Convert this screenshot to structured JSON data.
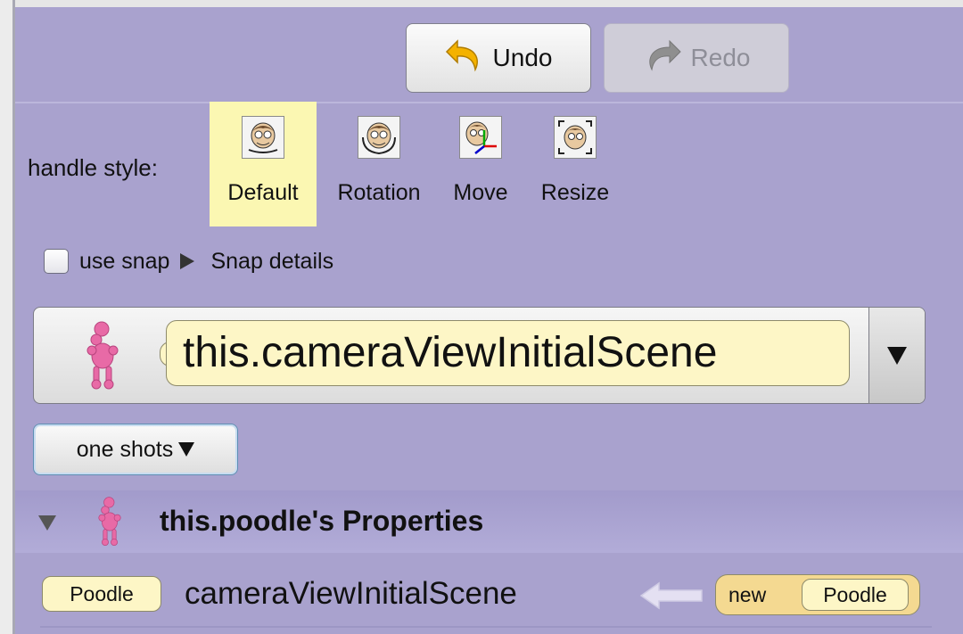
{
  "toolbar": {
    "undo_label": "Undo",
    "redo_label": "Redo",
    "redo_enabled": false
  },
  "handle_style": {
    "label": "handle style:",
    "options": [
      {
        "label": "Default",
        "selected": true
      },
      {
        "label": "Rotation",
        "selected": false
      },
      {
        "label": "Move",
        "selected": false
      },
      {
        "label": "Resize",
        "selected": false
      }
    ]
  },
  "snap": {
    "checkbox_label": "use snap",
    "checked": false,
    "details_label": "Snap details"
  },
  "object_selector": {
    "value": "this.cameraViewInitialScene"
  },
  "one_shots": {
    "label": "one shots"
  },
  "properties": {
    "title": "this.poodle's Properties",
    "rows": [
      {
        "type_tag": "Poodle",
        "name": "cameraViewInitialScene",
        "new_keyword": "new",
        "new_type": "Poodle"
      }
    ]
  },
  "colors": {
    "panel": "#a9a2ce",
    "selected_highlight": "#fbf7b2",
    "tile_yellow": "#fdf6c6",
    "new_tile": "#f4d991"
  }
}
